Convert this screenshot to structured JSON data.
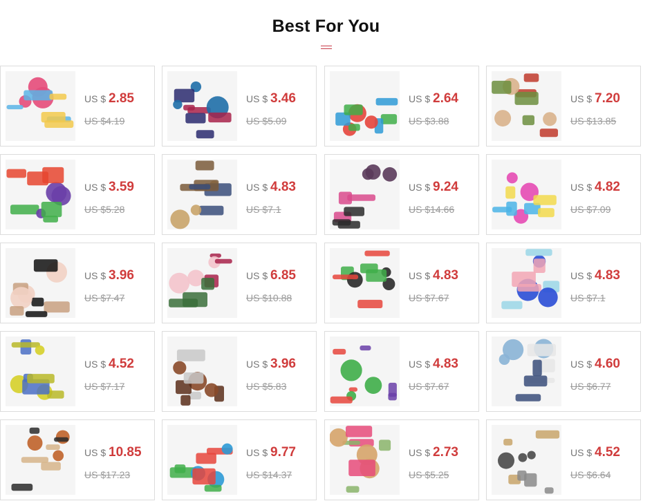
{
  "section": {
    "title": "Best For You"
  },
  "currency_prefix": "US $",
  "products": [
    {
      "price": "2.85",
      "old_price": "US $4.19",
      "icon": "sewing-pins-icon",
      "colors": [
        "#e64b7a",
        "#5ab4e6",
        "#f2c94c"
      ]
    },
    {
      "price": "3.46",
      "old_price": "US $5.09",
      "icon": "embroidered-butterflies-icon",
      "colors": [
        "#1f6fa8",
        "#a8224a",
        "#2a2a6e"
      ]
    },
    {
      "price": "2.64",
      "old_price": "US $3.88",
      "icon": "braided-cords-icon",
      "colors": [
        "#e6453c",
        "#2e9ad6",
        "#3fae49"
      ]
    },
    {
      "price": "7.20",
      "old_price": "US $13.85",
      "icon": "craft-box-icon",
      "colors": [
        "#d9b38c",
        "#c0392b",
        "#6c8e3e"
      ]
    },
    {
      "price": "3.59",
      "old_price": "US $5.28",
      "icon": "ribbon-bundle-icon",
      "colors": [
        "#6a3fa8",
        "#e6452f",
        "#3fae49"
      ]
    },
    {
      "price": "4.83",
      "old_price": "US $7.1",
      "icon": "butterfly-buckle-icon",
      "colors": [
        "#c9a46a",
        "#7a5a3a",
        "#3a4e7a"
      ]
    },
    {
      "price": "9.24",
      "old_price": "US $14.66",
      "icon": "printed-ribbons-icon",
      "colors": [
        "#5a3a5a",
        "#d94a8c",
        "#2a2a2a"
      ]
    },
    {
      "price": "4.82",
      "old_price": "US $7.09",
      "icon": "rainbow-tulle-icon",
      "colors": [
        "#e64bb4",
        "#4bb4e6",
        "#f2d94c"
      ]
    },
    {
      "price": "3.96",
      "old_price": "US $7.47",
      "icon": "scarf-ring-icon",
      "colors": [
        "#f2d2c4",
        "#c8a080",
        "#111111"
      ]
    },
    {
      "price": "6.85",
      "old_price": "US $10.88",
      "icon": "vase-icon",
      "colors": [
        "#f4c4cc",
        "#a8224a",
        "#3a6e3a"
      ]
    },
    {
      "price": "4.83",
      "old_price": "US $7.67",
      "icon": "elastic-loops-icon",
      "colors": [
        "#2a2a2a",
        "#3fae49",
        "#e6453c"
      ]
    },
    {
      "price": "4.83",
      "old_price": "US $7.1",
      "icon": "pleated-trim-icon",
      "colors": [
        "#2a4ed6",
        "#f2a6b4",
        "#9ad6e6"
      ]
    },
    {
      "price": "4.52",
      "old_price": "US $7.17",
      "icon": "mosaic-tiles-icon",
      "colors": [
        "#d6d02a",
        "#4a6ec4",
        "#b8b828"
      ]
    },
    {
      "price": "3.96",
      "old_price": "US $5.83",
      "icon": "needle-case-icon",
      "colors": [
        "#8a4a2a",
        "#5a2e1a",
        "#c8c8c8"
      ]
    },
    {
      "price": "4.83",
      "old_price": "US $7.67",
      "icon": "knot-buttons-icon",
      "colors": [
        "#3fae49",
        "#e6453c",
        "#6a3fa8"
      ]
    },
    {
      "price": "4.60",
      "old_price": "US $6.77",
      "icon": "sailboat-figures-icon",
      "colors": [
        "#8ab4d6",
        "#e6e6e6",
        "#3a4e7a"
      ]
    },
    {
      "price": "10.85",
      "old_price": "US $17.23",
      "icon": "resin-buttons-icon",
      "colors": [
        "#c0632a",
        "#d6b48a",
        "#2a2a2a"
      ]
    },
    {
      "price": "9.77",
      "old_price": "US $14.37",
      "icon": "glass-beads-icon",
      "colors": [
        "#2e9ad6",
        "#e6453c",
        "#3fae49"
      ]
    },
    {
      "price": "2.73",
      "old_price": "US $5.25",
      "icon": "twine-spools-icon",
      "colors": [
        "#d6a46a",
        "#e64b7a",
        "#8ab46a"
      ]
    },
    {
      "price": "4.52",
      "old_price": "US $6.64",
      "icon": "metal-spikes-icon",
      "colors": [
        "#4a4a4a",
        "#c8a46a",
        "#8a8a8a"
      ]
    }
  ]
}
